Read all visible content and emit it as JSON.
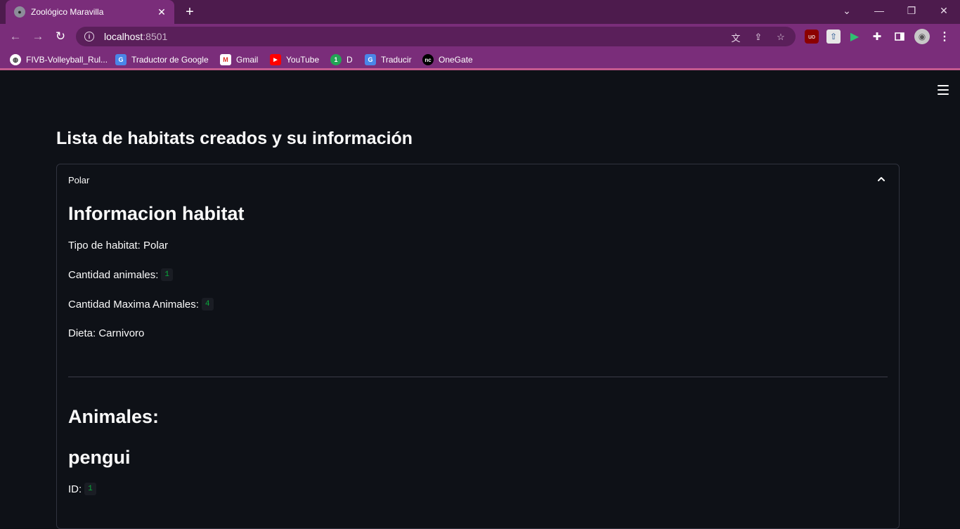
{
  "browser": {
    "tab_title": "Zoológico Maravilla",
    "new_tab": "+",
    "url_host": "localhost",
    "url_port": ":8501",
    "bookmarks": [
      {
        "label": "FIVB-Volleyball_Rul..."
      },
      {
        "label": "Traductor de Google"
      },
      {
        "label": "Gmail"
      },
      {
        "label": "YouTube"
      },
      {
        "label": "D"
      },
      {
        "label": "Traducir"
      },
      {
        "label": "OneGate"
      }
    ]
  },
  "page": {
    "title": "Lista de habitats creados y su información",
    "expander": {
      "label": "Polar",
      "info_heading": "Informacion habitat",
      "tipo_label": "Tipo de habitat: Polar",
      "cantidad_label": "Cantidad animales:",
      "cantidad_value": "1",
      "maxima_label": "Cantidad Maxima Animales:",
      "maxima_value": "4",
      "dieta_label": "Dieta: Carnivoro",
      "animales_heading": "Animales:",
      "animal_name": "pengui",
      "id_label": "ID:",
      "id_value": "1"
    }
  },
  "colors": {
    "titlebar": "#4d1b4d",
    "toolbar": "#7a2d7a",
    "app_bg": "#0e1117",
    "code_text": "#09ab3b"
  }
}
